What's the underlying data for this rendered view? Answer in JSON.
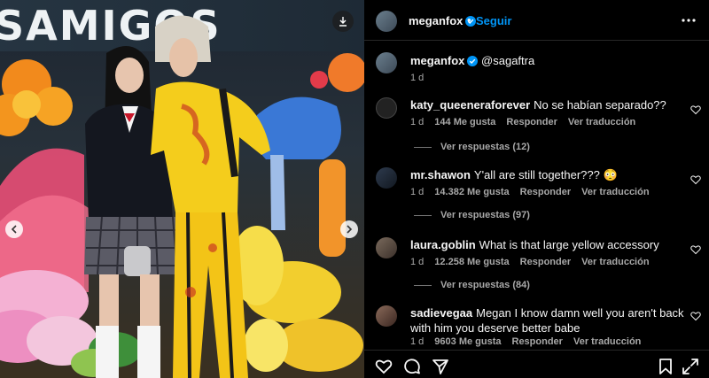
{
  "photo": {
    "banner_text": "SAMIGOS",
    "save_icon": "download-icon",
    "prev_icon": "chevron-left-icon",
    "next_icon": "chevron-right-icon"
  },
  "header": {
    "username": "meganfox",
    "separator": "•",
    "follow_label": "Seguir",
    "more_icon": "more-horizontal-icon"
  },
  "caption": {
    "username": "meganfox",
    "text": "@sagaftra",
    "time": "1 d"
  },
  "comments": [
    {
      "username": "katy_queeneraforever",
      "text": "No se habían separado??",
      "time": "1 d",
      "likes": "144 Me gusta",
      "reply": "Responder",
      "translate": "Ver traducción",
      "replies": "Ver respuestas (12)"
    },
    {
      "username": "mr.shawon",
      "text": "Y'all are still together??? 😳",
      "time": "1 d",
      "likes": "14.382 Me gusta",
      "reply": "Responder",
      "translate": "Ver traducción",
      "replies": "Ver respuestas (97)"
    },
    {
      "username": "laura.goblin",
      "text": "What is that large yellow accessory",
      "time": "1 d",
      "likes": "12.258 Me gusta",
      "reply": "Responder",
      "translate": "Ver traducción",
      "replies": "Ver respuestas (84)"
    },
    {
      "username": "sadievegaa",
      "text": "Megan I know damn well you aren't back with him you deserve better babe",
      "time": "1 d",
      "likes": "9603 Me gusta",
      "reply": "Responder",
      "translate": "Ver traducción"
    }
  ],
  "actions": {
    "like_icon": "heart-icon",
    "comment_icon": "comment-icon",
    "share_icon": "send-icon",
    "save_icon": "bookmark-icon"
  },
  "colors": {
    "accent": "#0095f6",
    "background": "#000000",
    "muted_text": "#a8a8a8",
    "verified": "#0095f6"
  }
}
